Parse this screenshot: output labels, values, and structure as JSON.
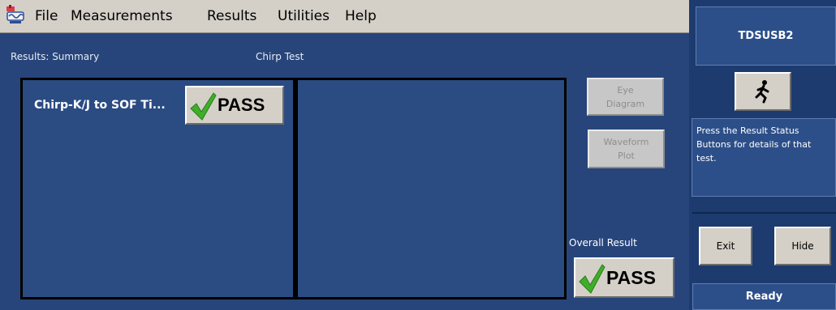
{
  "menu": {
    "items": [
      "File",
      "Measurements",
      "Results",
      "Utilities",
      "Help"
    ]
  },
  "results": {
    "caption": "Results: Summary",
    "test_name": "Chirp Test",
    "test_label": "Chirp-K/J to SOF Ti...",
    "test_status": "PASS"
  },
  "side_buttons": {
    "eye_diagram": [
      "Eye",
      "Diagram"
    ],
    "waveform_plot": [
      "Waveform",
      "Plot"
    ]
  },
  "overall": {
    "label": "Overall Result",
    "status": "PASS"
  },
  "right_panel": {
    "title": "TDSUSB2",
    "help_text": "Press the Result Status Buttons for details of that test.",
    "exit_label": "Exit",
    "hide_label": "Hide",
    "status": "Ready"
  },
  "colors": {
    "pass_check": "#3fae2a",
    "panel_background": "#27457a"
  },
  "icons": {
    "app": "oscilloscope-app-icon",
    "run": "running-man-icon",
    "check": "green-checkmark-icon"
  }
}
